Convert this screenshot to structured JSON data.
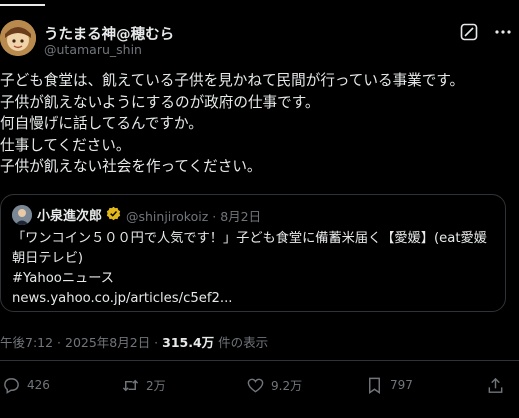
{
  "top": {
    "partial_title": "?????"
  },
  "author": {
    "name": "うたまる神@穂むら",
    "handle": "@utamaru_shin"
  },
  "post": {
    "lines": [
      "子ども食堂は、飢えている子供を見かねて民間が行っている事業です。",
      "子供が飢えないようにするのが政府の仕事です。",
      "何自慢げに話してるんですか。",
      "仕事してください。",
      "子供が飢えない社会を作ってください。"
    ]
  },
  "quote": {
    "author_name": "小泉進次郎",
    "author_handle": "@shinjirokoiz",
    "date": "· 8月2日",
    "lines": [
      "「ワンコイン５００円で人気です！」子ども食堂に備蓄米届く【愛媛】(eat愛媛",
      "朝日テレビ)",
      "#Yahooニュース",
      "news.yahoo.co.jp/articles/c5ef2..."
    ]
  },
  "meta": {
    "time_date": "午後7:12 · 2025年8月2日 · ",
    "views_count": "315.4万",
    "views_label": " 件の表示"
  },
  "actions": {
    "replies": "426",
    "reposts": "2万",
    "likes": "9.2万",
    "bookmarks": "797"
  },
  "icons": {
    "more": "more-icon",
    "grok": "grok-icon",
    "verified": "verified-badge-icon",
    "reply": "reply-icon",
    "repost": "repost-icon",
    "like": "heart-icon",
    "bookmark": "bookmark-icon",
    "share": "share-icon"
  },
  "colors": {
    "background": "#000000",
    "text": "#e7e9ea",
    "secondary": "#71767b",
    "border": "#2f3336",
    "verified_gold": "#e2b719"
  }
}
